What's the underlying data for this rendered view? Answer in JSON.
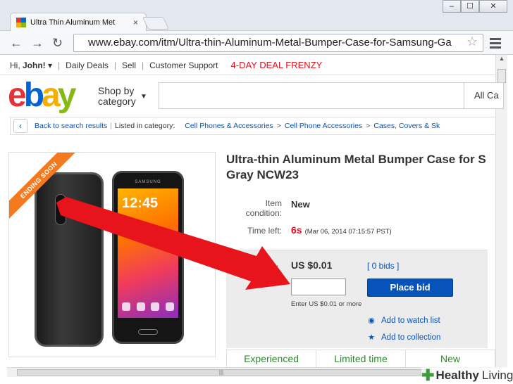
{
  "browser": {
    "tab_title": "Ultra Thin Aluminum Met",
    "tab_close": "×",
    "url": "www.ebay.com/itm/Ultra-thin-Aluminum-Metal-Bumper-Case-for-Samsung-Ga",
    "win_min": "–",
    "win_max": "☐",
    "win_close": "✕"
  },
  "topnav": {
    "greeting_prefix": "Hi, ",
    "user": "John!",
    "items": [
      "Daily Deals",
      "Sell",
      "Customer Support"
    ],
    "promo": "4-DAY DEAL FRENZY"
  },
  "header": {
    "logo_letters": [
      "e",
      "b",
      "a",
      "y"
    ],
    "logo_colors": [
      "#e53238",
      "#0064d2",
      "#f5af02",
      "#86b817"
    ],
    "shop_by_line1": "Shop by",
    "shop_by_line2": "category",
    "search_category": "All Ca"
  },
  "breadcrumb": {
    "back_label": "Back to search results",
    "listed_label": "Listed in category:",
    "categories": [
      "Cell Phones & Accessories",
      "Cell Phone Accessories",
      "Cases, Covers & Sk"
    ]
  },
  "item": {
    "ribbon": "ENDING SOON",
    "phone_brand": "SAMSUNG",
    "phone_time": "12:45",
    "title_line1": "Ultra-thin Aluminum Metal Bumper Case for S",
    "title_line2": "Gray NCW23",
    "condition_label_1": "Item",
    "condition_label_2": "condition:",
    "condition": "New",
    "time_left_label": "Time left:",
    "time_left": "6s",
    "end_date": "(Mar 06, 2014   07:15:57 PST)"
  },
  "bid": {
    "label": "bid:",
    "price": "US $0.01",
    "bids": "[ 0 bids ]",
    "input_value": "",
    "place_bid": "Place bid",
    "hint": "Enter US $0.01 or more",
    "watch_list": "Add to watch list",
    "collection": "Add to collection"
  },
  "cards": [
    "Experienced",
    "Limited time",
    "New"
  ],
  "watermark": {
    "word1": "Healthy",
    "word2": "Living"
  },
  "colors": {
    "arrow": "#e8141b",
    "ebay_blue": "#0654ba",
    "ribbon": "#f47a1f"
  }
}
